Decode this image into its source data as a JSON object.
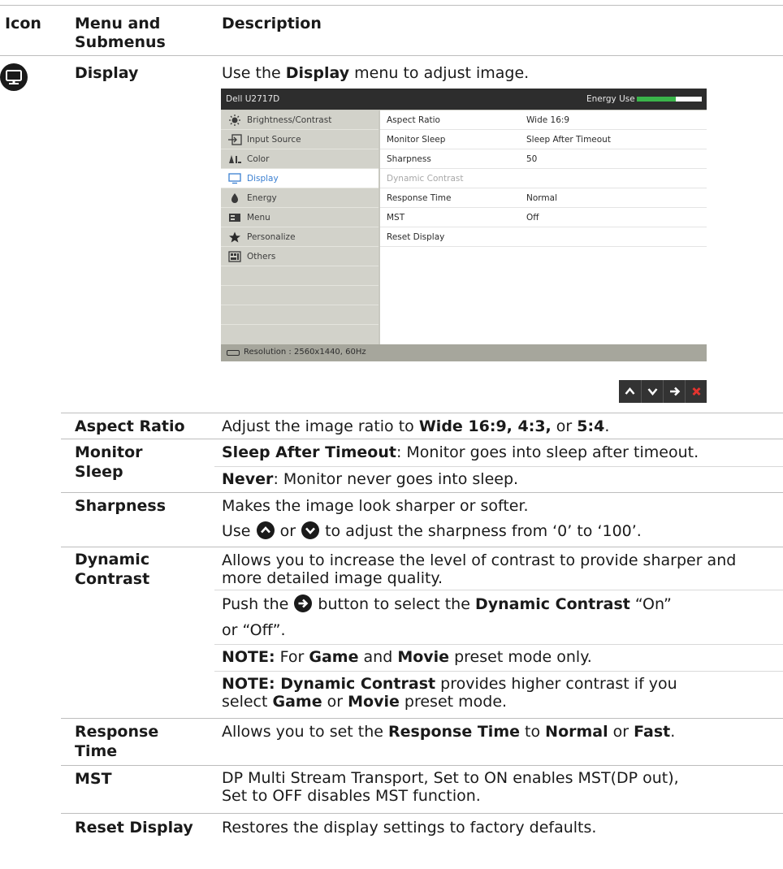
{
  "header": {
    "col_icon": "Icon",
    "col_menu": "Menu and Submenus",
    "col_desc": "Description"
  },
  "display": {
    "label": "Display",
    "desc_prefix": "Use the ",
    "desc_bold": "Display",
    "desc_suffix": " menu to adjust image."
  },
  "osd": {
    "model": "Dell U2717D",
    "energy_label": "Energy Use",
    "energy_level": 0.6,
    "energy_color": "#3ab54a",
    "active_color": "#3a7fd1",
    "menu": [
      {
        "label": "Brightness/Contrast",
        "icon": "brightness-icon"
      },
      {
        "label": "Input Source",
        "icon": "input-source-icon"
      },
      {
        "label": "Color",
        "icon": "color-icon"
      },
      {
        "label": "Display",
        "icon": "display-icon",
        "active": true
      },
      {
        "label": "Energy",
        "icon": "energy-icon"
      },
      {
        "label": "Menu",
        "icon": "menu-icon"
      },
      {
        "label": "Personalize",
        "icon": "star-icon"
      },
      {
        "label": "Others",
        "icon": "others-icon"
      }
    ],
    "settings": [
      {
        "name": "Aspect Ratio",
        "value": "Wide 16:9"
      },
      {
        "name": "Monitor Sleep",
        "value": "Sleep After Timeout"
      },
      {
        "name": "Sharpness",
        "value": "50"
      },
      {
        "name": "Dynamic Contrast",
        "value": "",
        "disabled": true
      },
      {
        "name": "Response Time",
        "value": "Normal"
      },
      {
        "name": "MST",
        "value": "Off"
      },
      {
        "name": "Reset Display",
        "value": ""
      }
    ],
    "status": "Resolution : 2560x1440, 60Hz",
    "buttons": [
      "up-arrow-icon",
      "down-arrow-icon",
      "right-arrow-icon",
      "close-icon"
    ]
  },
  "rows": {
    "aspect": {
      "label": "Aspect Ratio",
      "t1": "Adjust the image ratio to ",
      "b1": "Wide 16:9, 4:3,",
      "t2": " or ",
      "b2": "5:4",
      "t3": "."
    },
    "sleep": {
      "label1": "Monitor",
      "label2": "Sleep",
      "b1": "Sleep After Timeout",
      "t1": ": Monitor goes into sleep after timeout.",
      "b2": "Never",
      "t2": ": Monitor never goes into sleep."
    },
    "sharp": {
      "label": "Sharpness",
      "line1": "Makes the image look sharper or softer.",
      "t1": "Use ",
      "t2": " or ",
      "t3": " to adjust the sharpness from ‘0’ to ‘100’."
    },
    "dyn": {
      "label1": "Dynamic",
      "label2": "Contrast",
      "p1": "Allows you to increase the level of contrast to provide sharper and more detailed image quality.",
      "p2a": "Push the ",
      "p2b": " button to select the ",
      "p2c": "Dynamic Contrast",
      "p2d": " “On”",
      "p2e": "or “Off”.",
      "n1a": "NOTE:",
      "n1b": " For ",
      "n1c": "Game",
      "n1d": " and ",
      "n1e": "Movie",
      "n1f": " preset mode only.",
      "n2a": "NOTE: Dynamic Contrast",
      "n2b": " provides higher contrast if you",
      "n2c": "select ",
      "n2d": "Game",
      "n2e": " or ",
      "n2f": "Movie",
      "n2g": " preset mode."
    },
    "resp": {
      "label1": "Response",
      "label2": "Time",
      "t1": "Allows you to set the ",
      "b1": "Response Time",
      "t2": " to ",
      "b2": "Normal",
      "t3": " or ",
      "b3": "Fast",
      "t4": "."
    },
    "mst": {
      "label": "MST",
      "line1": "DP Multi Stream Transport,  Set to ON enables MST(DP out),",
      "line2": "Set to OFF disables MST function."
    },
    "reset": {
      "label": "Reset Display",
      "text": "Restores the display settings to factory defaults."
    }
  }
}
